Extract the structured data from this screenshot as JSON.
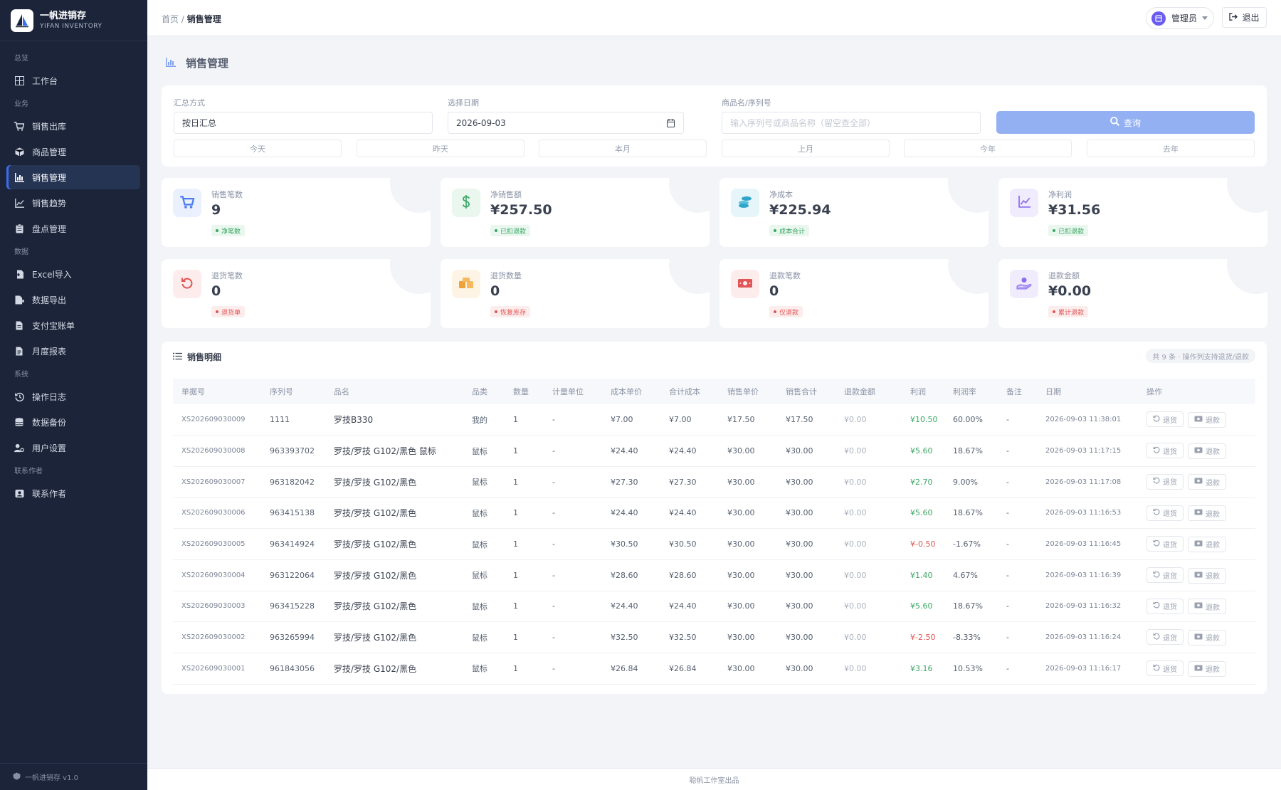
{
  "brand": {
    "name": "一帆进销存",
    "sub": "YIFAN INVENTORY"
  },
  "sidebar": {
    "groups": [
      {
        "label": "总览",
        "items": [
          {
            "label": "工作台",
            "icon": "dashboard-icon"
          }
        ]
      },
      {
        "label": "业务",
        "items": [
          {
            "label": "销售出库",
            "icon": "cart-icon"
          },
          {
            "label": "商品管理",
            "icon": "box-icon"
          },
          {
            "label": "销售管理",
            "icon": "chart-bar-icon",
            "active": true
          },
          {
            "label": "销售趋势",
            "icon": "trend-icon"
          },
          {
            "label": "盘点管理",
            "icon": "clipboard-icon"
          }
        ]
      },
      {
        "label": "数据",
        "items": [
          {
            "label": "Excel导入",
            "icon": "import-icon"
          },
          {
            "label": "数据导出",
            "icon": "export-icon"
          },
          {
            "label": "支付宝账单",
            "icon": "file-icon"
          },
          {
            "label": "月度报表",
            "icon": "report-icon"
          }
        ]
      },
      {
        "label": "系统",
        "items": [
          {
            "label": "操作日志",
            "icon": "history-icon"
          },
          {
            "label": "数据备份",
            "icon": "database-icon"
          },
          {
            "label": "用户设置",
            "icon": "user-gear-icon"
          }
        ]
      },
      {
        "label": "联系作者",
        "items": [
          {
            "label": "联系作者",
            "icon": "contact-icon"
          }
        ]
      }
    ],
    "footer": "一帆进销存 v1.0"
  },
  "header": {
    "breadcrumb_home": "首页",
    "breadcrumb_sep": "/",
    "breadcrumb_current": "销售管理",
    "user_name": "管理员",
    "logout": "退出"
  },
  "page": {
    "title": "销售管理"
  },
  "filters": {
    "mode_label": "汇总方式",
    "mode_value": "按日汇总",
    "date_label": "选择日期",
    "date_value": "2026-09-03",
    "keyword_label": "商品名/序列号",
    "keyword_placeholder": "输入序列号或商品名称（留空查全部）",
    "search": "查询",
    "quick": [
      "今天",
      "昨天",
      "本月",
      "上月",
      "今年",
      "去年"
    ]
  },
  "stats": [
    {
      "label": "销售笔数",
      "value": "9",
      "tag": "净笔数",
      "tone": "green",
      "icon": "cart-icon",
      "color": "#4a7cf0",
      "bg": "#eaf0fd"
    },
    {
      "label": "净销售额",
      "value": "¥257.50",
      "tag": "已扣退款",
      "tone": "green",
      "icon": "dollar-icon",
      "color": "#3aa764",
      "bg": "#e9f7ee"
    },
    {
      "label": "净成本",
      "value": "¥225.94",
      "tag": "成本合计",
      "tone": "green",
      "icon": "coins-icon",
      "color": "#2fa6c9",
      "bg": "#e6f5fa"
    },
    {
      "label": "净利润",
      "value": "¥31.56",
      "tag": "已扣退款",
      "tone": "green",
      "icon": "trend-icon",
      "color": "#8a6cf0",
      "bg": "#f0ecfd"
    },
    {
      "label": "退货笔数",
      "value": "0",
      "tag": "退货单",
      "tone": "red",
      "icon": "undo-icon",
      "color": "#e05555",
      "bg": "#fdecec"
    },
    {
      "label": "退货数量",
      "value": "0",
      "tag": "恢复库存",
      "tone": "red",
      "icon": "boxes-icon",
      "color": "#f0a23a",
      "bg": "#fdf4e6"
    },
    {
      "label": "退款笔数",
      "value": "0",
      "tag": "仅退款",
      "tone": "red",
      "icon": "money-icon",
      "color": "#e05555",
      "bg": "#fdecec"
    },
    {
      "label": "退款金额",
      "value": "¥0.00",
      "tag": "累计退款",
      "tone": "red",
      "icon": "hand-money-icon",
      "color": "#8a6cf0",
      "bg": "#f0ecfd"
    }
  ],
  "table": {
    "title": "销售明细",
    "count": "共 9 条 · 操作列支持退货/退款",
    "columns": [
      "单据号",
      "序列号",
      "品名",
      "品类",
      "数量",
      "计量单位",
      "成本单价",
      "合计成本",
      "销售单价",
      "销售合计",
      "退款金额",
      "利润",
      "利润率",
      "备注",
      "日期",
      "操作"
    ],
    "return_label": "退货",
    "refund_label": "退款",
    "rows": [
      {
        "no": "XS202609030009",
        "sn": "1111",
        "name": "罗技B330",
        "cat": "我的",
        "qty": "1",
        "unit": "-",
        "cost": "¥7.00",
        "cost_total": "¥7.00",
        "price": "¥17.50",
        "sales_total": "¥17.50",
        "refund": "¥0.00",
        "profit": "¥10.50",
        "rate": "60.00%",
        "note": "-",
        "date": "2026-09-03 11:38:01",
        "profit_tone": "pos"
      },
      {
        "no": "XS202609030008",
        "sn": "963393702",
        "name": "罗技/罗技 G102/黑色 鼠标",
        "cat": "鼠标",
        "qty": "1",
        "unit": "-",
        "cost": "¥24.40",
        "cost_total": "¥24.40",
        "price": "¥30.00",
        "sales_total": "¥30.00",
        "refund": "¥0.00",
        "profit": "¥5.60",
        "rate": "18.67%",
        "note": "-",
        "date": "2026-09-03 11:17:15",
        "profit_tone": "pos"
      },
      {
        "no": "XS202609030007",
        "sn": "963182042",
        "name": "罗技/罗技 G102/黑色",
        "cat": "鼠标",
        "qty": "1",
        "unit": "-",
        "cost": "¥27.30",
        "cost_total": "¥27.30",
        "price": "¥30.00",
        "sales_total": "¥30.00",
        "refund": "¥0.00",
        "profit": "¥2.70",
        "rate": "9.00%",
        "note": "-",
        "date": "2026-09-03 11:17:08",
        "profit_tone": "pos"
      },
      {
        "no": "XS202609030006",
        "sn": "963415138",
        "name": "罗技/罗技 G102/黑色",
        "cat": "鼠标",
        "qty": "1",
        "unit": "-",
        "cost": "¥24.40",
        "cost_total": "¥24.40",
        "price": "¥30.00",
        "sales_total": "¥30.00",
        "refund": "¥0.00",
        "profit": "¥5.60",
        "rate": "18.67%",
        "note": "-",
        "date": "2026-09-03 11:16:53",
        "profit_tone": "pos"
      },
      {
        "no": "XS202609030005",
        "sn": "963414924",
        "name": "罗技/罗技 G102/黑色",
        "cat": "鼠标",
        "qty": "1",
        "unit": "-",
        "cost": "¥30.50",
        "cost_total": "¥30.50",
        "price": "¥30.00",
        "sales_total": "¥30.00",
        "refund": "¥0.00",
        "profit": "¥-0.50",
        "rate": "-1.67%",
        "note": "-",
        "date": "2026-09-03 11:16:45",
        "profit_tone": "neg"
      },
      {
        "no": "XS202609030004",
        "sn": "963122064",
        "name": "罗技/罗技 G102/黑色",
        "cat": "鼠标",
        "qty": "1",
        "unit": "-",
        "cost": "¥28.60",
        "cost_total": "¥28.60",
        "price": "¥30.00",
        "sales_total": "¥30.00",
        "refund": "¥0.00",
        "profit": "¥1.40",
        "rate": "4.67%",
        "note": "-",
        "date": "2026-09-03 11:16:39",
        "profit_tone": "pos"
      },
      {
        "no": "XS202609030003",
        "sn": "963415228",
        "name": "罗技/罗技 G102/黑色",
        "cat": "鼠标",
        "qty": "1",
        "unit": "-",
        "cost": "¥24.40",
        "cost_total": "¥24.40",
        "price": "¥30.00",
        "sales_total": "¥30.00",
        "refund": "¥0.00",
        "profit": "¥5.60",
        "rate": "18.67%",
        "note": "-",
        "date": "2026-09-03 11:16:32",
        "profit_tone": "pos"
      },
      {
        "no": "XS202609030002",
        "sn": "963265994",
        "name": "罗技/罗技 G102/黑色",
        "cat": "鼠标",
        "qty": "1",
        "unit": "-",
        "cost": "¥32.50",
        "cost_total": "¥32.50",
        "price": "¥30.00",
        "sales_total": "¥30.00",
        "refund": "¥0.00",
        "profit": "¥-2.50",
        "rate": "-8.33%",
        "note": "-",
        "date": "2026-09-03 11:16:24",
        "profit_tone": "neg"
      },
      {
        "no": "XS202609030001",
        "sn": "961843056",
        "name": "罗技/罗技 G102/黑色",
        "cat": "鼠标",
        "qty": "1",
        "unit": "-",
        "cost": "¥26.84",
        "cost_total": "¥26.84",
        "price": "¥30.00",
        "sales_total": "¥30.00",
        "refund": "¥0.00",
        "profit": "¥3.16",
        "rate": "10.53%",
        "note": "-",
        "date": "2026-09-03 11:16:17",
        "profit_tone": "pos"
      }
    ]
  },
  "footer": "聪帆工作室出品",
  "colors": {
    "sidebar_bg": "#1b2438",
    "accent": "#3c6df0",
    "search_btn": "#93b0f2",
    "positive": "#3aa764",
    "negative": "#e05555"
  }
}
